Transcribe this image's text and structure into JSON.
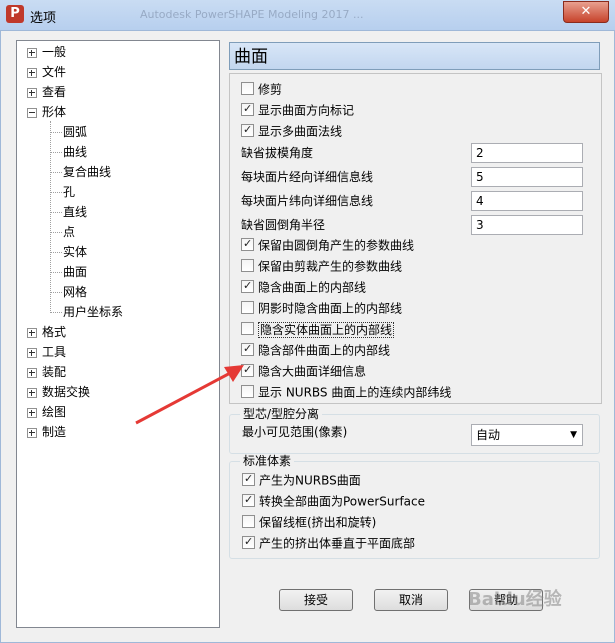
{
  "window": {
    "title": "选项",
    "background_title": "Autodesk PowerSHAPE Modeling 2017 ...",
    "close_glyph": "✕"
  },
  "tree": {
    "items": [
      {
        "label": "一般",
        "level": 0,
        "expander": "plus"
      },
      {
        "label": "文件",
        "level": 0,
        "expander": "plus"
      },
      {
        "label": "查看",
        "level": 0,
        "expander": "plus"
      },
      {
        "label": "形体",
        "level": 0,
        "expander": "minus"
      },
      {
        "label": "圆弧",
        "level": 1
      },
      {
        "label": "曲线",
        "level": 1
      },
      {
        "label": "复合曲线",
        "level": 1
      },
      {
        "label": "孔",
        "level": 1
      },
      {
        "label": "直线",
        "level": 1
      },
      {
        "label": "点",
        "level": 1
      },
      {
        "label": "实体",
        "level": 1
      },
      {
        "label": "曲面",
        "level": 1
      },
      {
        "label": "网格",
        "level": 1
      },
      {
        "label": "用户坐标系",
        "level": 1
      },
      {
        "label": "格式",
        "level": 0,
        "expander": "plus"
      },
      {
        "label": "工具",
        "level": 0,
        "expander": "plus"
      },
      {
        "label": "装配",
        "level": 0,
        "expander": "plus"
      },
      {
        "label": "数据交换",
        "level": 0,
        "expander": "plus"
      },
      {
        "label": "绘图",
        "level": 0,
        "expander": "plus"
      },
      {
        "label": "制造",
        "level": 0,
        "expander": "plus"
      }
    ]
  },
  "section": {
    "title": "曲面",
    "checks_top": [
      {
        "label": "修剪",
        "checked": false
      },
      {
        "label": "显示曲面方向标记",
        "checked": true
      },
      {
        "label": "显示多曲面法线",
        "checked": true
      }
    ],
    "fields": [
      {
        "label": "缺省拔模角度",
        "value": "2"
      },
      {
        "label": "每块面片经向详细信息线",
        "value": "5"
      },
      {
        "label": "每块面片纬向详细信息线",
        "value": "4"
      },
      {
        "label": "缺省圆倒角半径",
        "value": "3"
      }
    ],
    "checks_bottom": [
      {
        "label": "保留由圆倒角产生的参数曲线",
        "checked": true
      },
      {
        "label": "保留由剪裁产生的参数曲线",
        "checked": false
      },
      {
        "label": "隐含曲面上的内部线",
        "checked": true
      },
      {
        "label": "阴影时隐含曲面上的内部线",
        "checked": false
      },
      {
        "label": "隐含实体曲面上的内部线",
        "checked": false
      },
      {
        "label": "隐含部件曲面上的内部线",
        "checked": true
      },
      {
        "label": "隐含大曲面详细信息",
        "checked": true
      },
      {
        "label": "显示 NURBS 曲面上的连续内部纬线",
        "checked": false
      }
    ]
  },
  "core_cavity": {
    "title": "型芯/型腔分离",
    "label": "最小可见范围(像素)",
    "selected": "自动"
  },
  "primitives": {
    "title": "标准体素",
    "checks": [
      {
        "label": "产生为NURBS曲面",
        "checked": true
      },
      {
        "label": "转换全部曲面为PowerSurface",
        "checked": true
      },
      {
        "label": "保留线框(挤出和旋转)",
        "checked": false
      },
      {
        "label": "产生的挤出体垂直于平面底部",
        "checked": true
      }
    ]
  },
  "buttons": {
    "accept": "接受",
    "cancel": "取消",
    "help": "帮助"
  },
  "watermark": "Baidu经验",
  "colors": {
    "annotation_arrow": "#e53935",
    "heading_bg": "#c8daf1"
  }
}
